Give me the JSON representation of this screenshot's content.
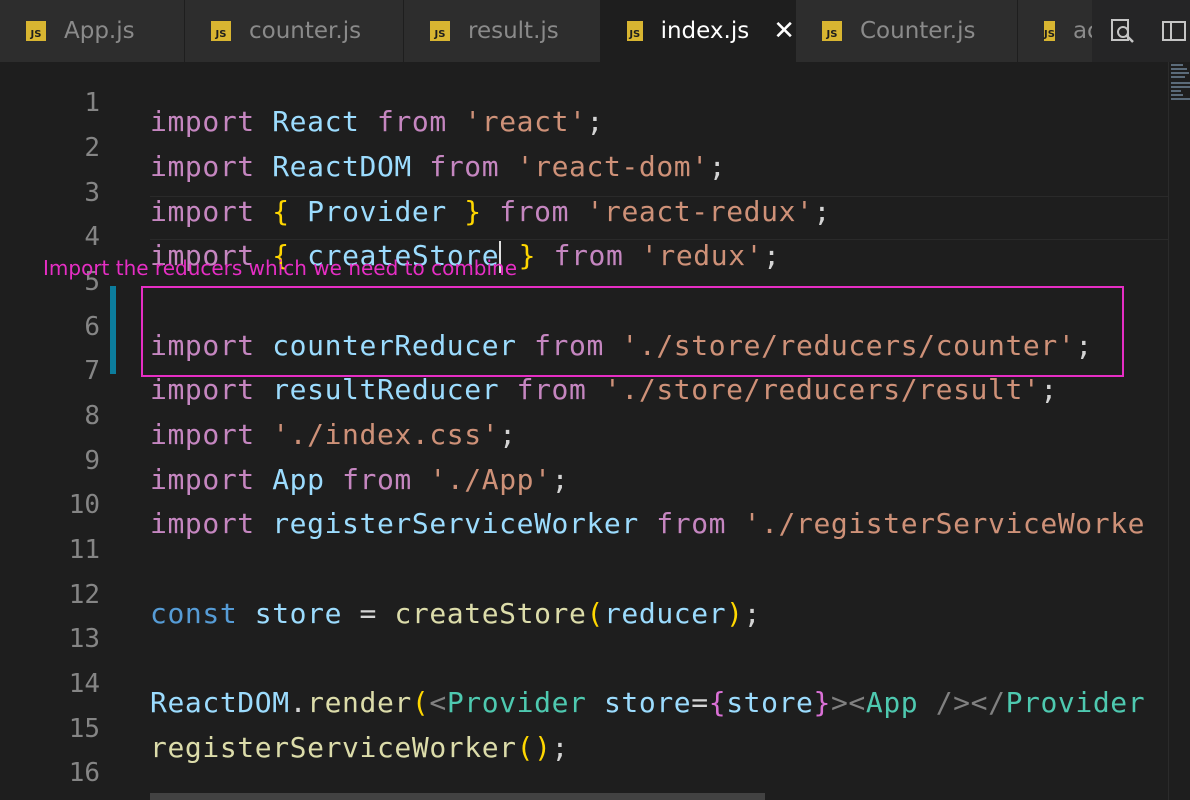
{
  "tabs": [
    {
      "label": "App.js",
      "icon": "js-file-icon",
      "active": false
    },
    {
      "label": "counter.js",
      "icon": "js-file-icon",
      "active": false
    },
    {
      "label": "result.js",
      "icon": "js-file-icon",
      "active": false
    },
    {
      "label": "index.js",
      "icon": "js-file-icon",
      "active": true
    },
    {
      "label": "Counter.js",
      "icon": "js-file-icon",
      "active": false
    },
    {
      "label": "ac",
      "icon": "js-file-icon",
      "active": false
    }
  ],
  "js_icon_text": "JS",
  "close_glyph": "✕",
  "toolbar_icons": [
    "find-icon",
    "split-editor-icon"
  ],
  "annotation": {
    "text": "Import the reducers which we need to combine",
    "color": "#e62ec4"
  },
  "line_numbers": [
    "1",
    "2",
    "3",
    "4",
    "5",
    "6",
    "7",
    "8",
    "9",
    "10",
    "11",
    "12",
    "13",
    "14",
    "15",
    "16"
  ],
  "code": {
    "l1": [
      "import",
      " ",
      "React",
      " ",
      "from",
      " ",
      "'react'",
      ";"
    ],
    "l2": [
      "import",
      " ",
      "ReactDOM",
      " ",
      "from",
      " ",
      "'react-dom'",
      ";"
    ],
    "l3": [
      "import",
      " ",
      "{",
      " ",
      "Provider",
      " ",
      "}",
      " ",
      "from",
      " ",
      "'react-redux'",
      ";"
    ],
    "l4": [
      "import",
      " ",
      "{",
      " ",
      "createStore",
      " ",
      "}",
      " ",
      "from",
      " ",
      "'redux'",
      ";"
    ],
    "l6": [
      "import",
      " ",
      "counterReducer",
      " ",
      "from",
      " ",
      "'./store/reducers/counter'",
      ";"
    ],
    "l7": [
      "import",
      " ",
      "resultReducer",
      " ",
      "from",
      " ",
      "'./store/reducers/result'",
      ";"
    ],
    "l8": [
      "import",
      " ",
      "'./index.css'",
      ";"
    ],
    "l9": [
      "import",
      " ",
      "App",
      " ",
      "from",
      " ",
      "'./App'",
      ";"
    ],
    "l10": [
      "import",
      " ",
      "registerServiceWorker",
      " ",
      "from",
      " ",
      "'./registerServiceWorke"
    ],
    "l12": [
      "const",
      " ",
      "store",
      " = ",
      "createStore",
      "(",
      "reducer",
      ")",
      ";"
    ],
    "l14": [
      "ReactDOM",
      ".",
      "render",
      "(",
      "<",
      "Provider",
      " ",
      "store",
      "=",
      "{",
      "store",
      "}",
      "><",
      "App",
      " /></",
      "Provider"
    ],
    "l15": [
      "registerServiceWorker",
      "(",
      ")",
      ";"
    ]
  },
  "colors": {
    "keyword": "#c586c0",
    "const_keyword": "#569cd6",
    "identifier": "#9cdcfe",
    "string": "#ce9178",
    "function": "#dcdcaa",
    "bracket": "#ffd700",
    "jsx_tag": "#4ec9b0",
    "background": "#1e1e1e"
  }
}
